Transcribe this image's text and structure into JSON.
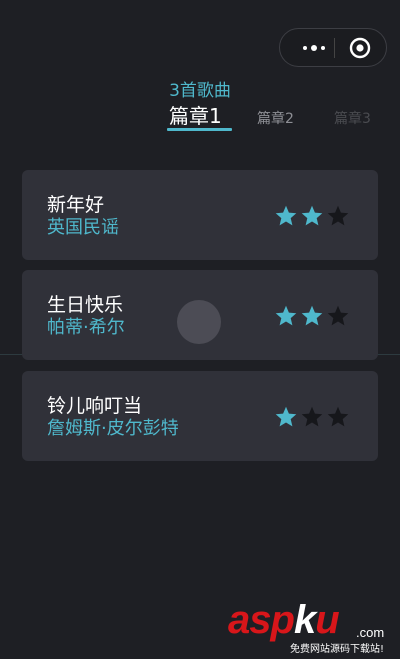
{
  "header": {
    "song_count": "3首歌曲",
    "tabs": [
      {
        "label": "篇章1",
        "active": true
      },
      {
        "label": "篇章2",
        "active": false
      },
      {
        "label": "篇章3",
        "active": false
      }
    ]
  },
  "capsule": {
    "more_icon": "more-dots-icon",
    "close_icon": "target-circle-icon"
  },
  "songs": [
    {
      "title": "新年好",
      "artist": "英国民谣",
      "stars": 2,
      "max_stars": 3
    },
    {
      "title": "生日快乐",
      "artist": "帕蒂·希尔",
      "stars": 2,
      "max_stars": 3
    },
    {
      "title": "铃儿响叮当",
      "artist": "詹姆斯·皮尔彭特",
      "stars": 1,
      "max_stars": 3
    }
  ],
  "watermark": {
    "part1": "asp",
    "part2": "k",
    "part3": "u",
    "suffix": ".com",
    "subtitle": "免费网站源码下载站!"
  },
  "colors": {
    "accent": "#4fb8cc",
    "star_filled": "#4fb8cc",
    "star_empty": "#16171b",
    "background": "#1e1f24",
    "card": "#303139"
  }
}
